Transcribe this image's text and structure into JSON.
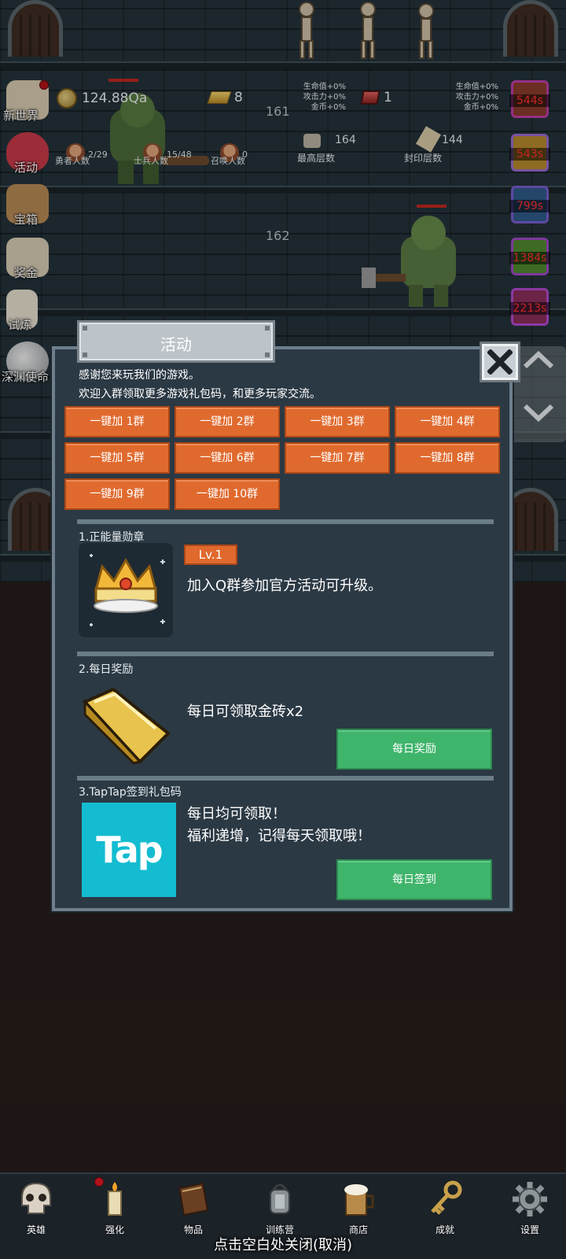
{
  "game_bg": {
    "floors": [
      {
        "number": "161"
      },
      {
        "number": "162"
      }
    ],
    "stats": {
      "gold": "124.88Qa",
      "gold_bars": "8",
      "gems": "1",
      "bonus_left": [
        "生命值+0%",
        "攻击力+0%",
        "金币+0%"
      ],
      "bonus_right": [
        "生命值+0%",
        "攻击力+0%",
        "金币+0%"
      ],
      "heroes": {
        "value": "2/29",
        "label": "勇者人数"
      },
      "soldiers": {
        "value": "15/48",
        "label": "士兵人数"
      },
      "summons": {
        "value": "0",
        "label": "召唤人数"
      },
      "max_floor": {
        "value": "164",
        "label": "最高层数"
      },
      "seal_floor": {
        "value": "144",
        "label": "封印层数"
      }
    },
    "left_menu": [
      {
        "label": "新世界",
        "icon": "scroll-icon"
      },
      {
        "label": "活动",
        "icon": "heart-icon"
      },
      {
        "label": "宝箱",
        "icon": "chest-icon"
      },
      {
        "label": "奖金",
        "icon": "envelope-icon"
      },
      {
        "label": "试炼",
        "icon": "feather-icon"
      },
      {
        "label": "深渊使命",
        "icon": "orb-icon"
      }
    ],
    "timers": [
      "544s",
      "543s",
      "799s",
      "1384s",
      "2213s"
    ]
  },
  "dialog": {
    "title": "活动",
    "intro_line1": "感谢您来玩我们的游戏。",
    "intro_line2": "欢迎入群领取更多游戏礼包码，和更多玩家交流。",
    "group_buttons": [
      "一键加 1群",
      "一键加 2群",
      "一键加 3群",
      "一键加 4群",
      "一键加 5群",
      "一键加 6群",
      "一键加 7群",
      "一键加 8群",
      "一键加 9群",
      "一键加 10群"
    ],
    "section1": {
      "title": "1.正能量勋章",
      "level": "Lv.1",
      "text": "加入Q群参加官方活动可升级。"
    },
    "section2": {
      "title": "2.每日奖励",
      "text": "每日可领取金砖x2",
      "button": "每日奖励"
    },
    "section3": {
      "title": "3.TapTap签到礼包码",
      "text_line1": "每日均可领取！",
      "text_line2": "福利递增，记得每天领取哦！",
      "logo_text": "Tap",
      "button": "每日签到"
    }
  },
  "bottom_nav": [
    {
      "label": "英雄",
      "icon": "skull-icon"
    },
    {
      "label": "强化",
      "icon": "candle-icon"
    },
    {
      "label": "物品",
      "icon": "book-icon"
    },
    {
      "label": "训练营",
      "icon": "lantern-icon"
    },
    {
      "label": "商店",
      "icon": "beer-mug-icon"
    },
    {
      "label": "成就",
      "icon": "key-icon"
    },
    {
      "label": "设置",
      "icon": "gear-icon"
    }
  ],
  "close_hint": "点击空白处关闭(取消)",
  "colors": {
    "accent_orange": "#e06a2e",
    "button_green": "#3fb56b",
    "dialog_bg": "#2b3944",
    "timer_red": "#ff2f2f",
    "tap_cyan": "#14bcd1"
  }
}
